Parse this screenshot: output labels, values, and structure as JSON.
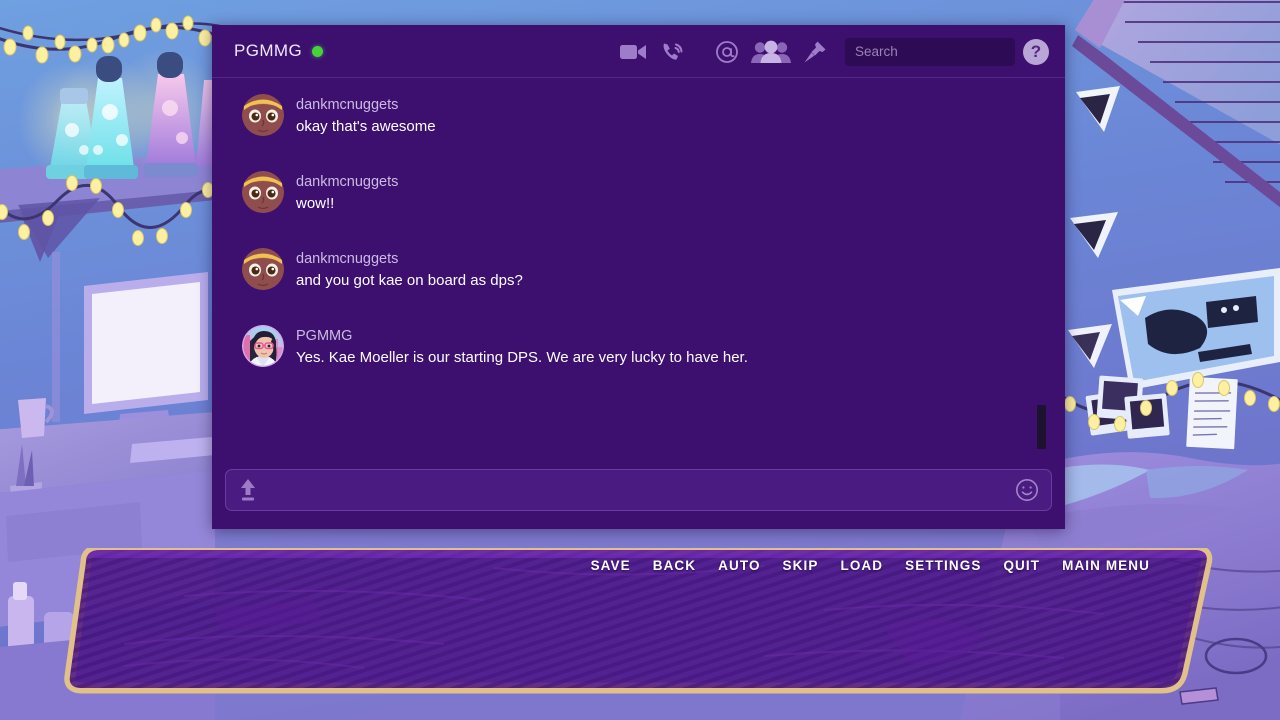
{
  "chat": {
    "server_name": "PGMMG",
    "status": "online",
    "status_color": "#44d43a",
    "header_icons": [
      "video-camera-icon",
      "phone-call-icon",
      "mention-at-icon",
      "members-icon",
      "pin-icon"
    ],
    "search": {
      "placeholder": "Search",
      "value": ""
    },
    "help_label": "?",
    "messages": [
      {
        "author": "dankmcnuggets",
        "text": "okay that's awesome",
        "avatar": "nuggets-face-avatar"
      },
      {
        "author": "dankmcnuggets",
        "text": "wow!!",
        "avatar": "nuggets-face-avatar"
      },
      {
        "author": "dankmcnuggets",
        "text": "and you got kae on board as dps?",
        "avatar": "nuggets-face-avatar"
      },
      {
        "author": "PGMMG",
        "text": "Yes. Kae Moeller is our starting DPS. We are very lucky to have her.",
        "avatar": "pgmmg-girl-avatar"
      }
    ],
    "composer": {
      "placeholder": "",
      "value": "",
      "upload_icon": "upload-arrow-icon",
      "emoji_icon": "emoji-smiley-icon"
    }
  },
  "vn_menu": {
    "items": [
      {
        "label": "SAVE"
      },
      {
        "label": "BACK"
      },
      {
        "label": "AUTO"
      },
      {
        "label": "SKIP"
      },
      {
        "label": "LOAD"
      },
      {
        "label": "SETTINGS"
      },
      {
        "label": "QUIT"
      },
      {
        "label": "MAIN MENU"
      }
    ]
  },
  "colors": {
    "chat_bg": "#3d1070",
    "chat_header_bg": "#3d1070",
    "composer_bg": "#4a1b80",
    "accent_gold": "#e2c08a",
    "dialogue_fill": "#4b1486",
    "scene_wall": "#6b7fd0"
  },
  "dialogue": {
    "speaker": "",
    "text": ""
  }
}
